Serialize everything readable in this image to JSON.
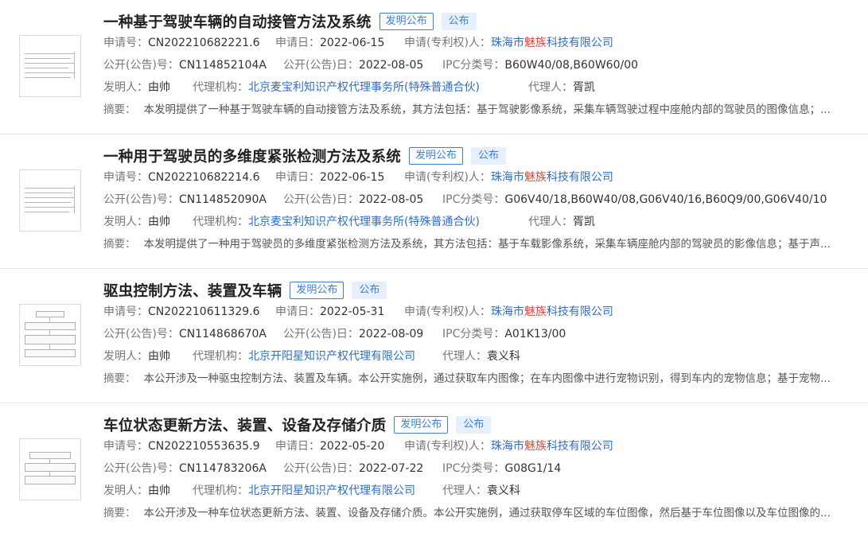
{
  "labels": {
    "app_no": "申请号：",
    "app_date": "申请日：",
    "applicant": "申请(专利权)人：",
    "pub_no": "公开(公告)号：",
    "pub_date": "公开(公告)日：",
    "ipc": "IPC分类号：",
    "inventor": "发明人：",
    "agency": "代理机构：",
    "agent": "代理人：",
    "abstract": "摘要："
  },
  "records": [
    {
      "title": "一种基于驾驶车辆的自动接管方法及系统",
      "type_badge": "发明公布",
      "status_badge": "公布",
      "app_no": "CN202210682221.6",
      "app_date": "2022-06-15",
      "applicant_pre": "珠海市",
      "applicant_hl": "魅族",
      "applicant_post": "科技有限公司",
      "pub_no": "CN114852104A",
      "pub_date": "2022-08-05",
      "ipc": "B60W40/08,B60W60/00",
      "inventor": "由帅",
      "agency": "北京麦宝利知识产权代理事务所(特殊普通合伙)",
      "agent": "胥凯",
      "abstract": "本发明提供了一种基于驾驶车辆的自动接管方法及系统，其方法包括：基于驾驶影像系统，采集车辆驾驶过程中座舱内部的驾驶员的图像信息；..."
    },
    {
      "title": "一种用于驾驶员的多维度紧张检测方法及系统",
      "type_badge": "发明公布",
      "status_badge": "公布",
      "app_no": "CN202210682214.6",
      "app_date": "2022-06-15",
      "applicant_pre": "珠海市",
      "applicant_hl": "魅族",
      "applicant_post": "科技有限公司",
      "pub_no": "CN114852090A",
      "pub_date": "2022-08-05",
      "ipc": "G06V40/18,B60W40/08,G06V40/16,B60Q9/00,G06V40/10",
      "inventor": "由帅",
      "agency": "北京麦宝利知识产权代理事务所(特殊普通合伙)",
      "agent": "胥凯",
      "abstract": "本发明提供了一种用于驾驶员的多维度紧张检测方法及系统，其方法包括：基于车载影像系统，采集车辆座舱内部的驾驶员的影像信息；基于声..."
    },
    {
      "title": "驱虫控制方法、装置及车辆",
      "type_badge": "发明公布",
      "status_badge": "公布",
      "app_no": "CN202210611329.6",
      "app_date": "2022-05-31",
      "applicant_pre": "珠海市",
      "applicant_hl": "魅族",
      "applicant_post": "科技有限公司",
      "pub_no": "CN114868670A",
      "pub_date": "2022-08-09",
      "ipc": "A01K13/00",
      "inventor": "由帅",
      "agency": "北京开阳星知识产权代理有限公司",
      "agent": "袁义科",
      "abstract": "本公开涉及一种驱虫控制方法、装置及车辆。本公开实施例，通过获取车内图像；在车内图像中进行宠物识别，得到车内的宠物信息；基于宠物..."
    },
    {
      "title": "车位状态更新方法、装置、设备及存储介质",
      "type_badge": "发明公布",
      "status_badge": "公布",
      "app_no": "CN202210553635.9",
      "app_date": "2022-05-20",
      "applicant_pre": "珠海市",
      "applicant_hl": "魅族",
      "applicant_post": "科技有限公司",
      "pub_no": "CN114783206A",
      "pub_date": "2022-07-22",
      "ipc": "G08G1/14",
      "inventor": "由帅",
      "agency": "北京开阳星知识产权代理有限公司",
      "agent": "袁义科",
      "abstract": "本公开涉及一种车位状态更新方法、装置、设备及存储介质。本公开实施例，通过获取停车区域的车位图像，然后基于车位图像以及车位图像的..."
    }
  ]
}
